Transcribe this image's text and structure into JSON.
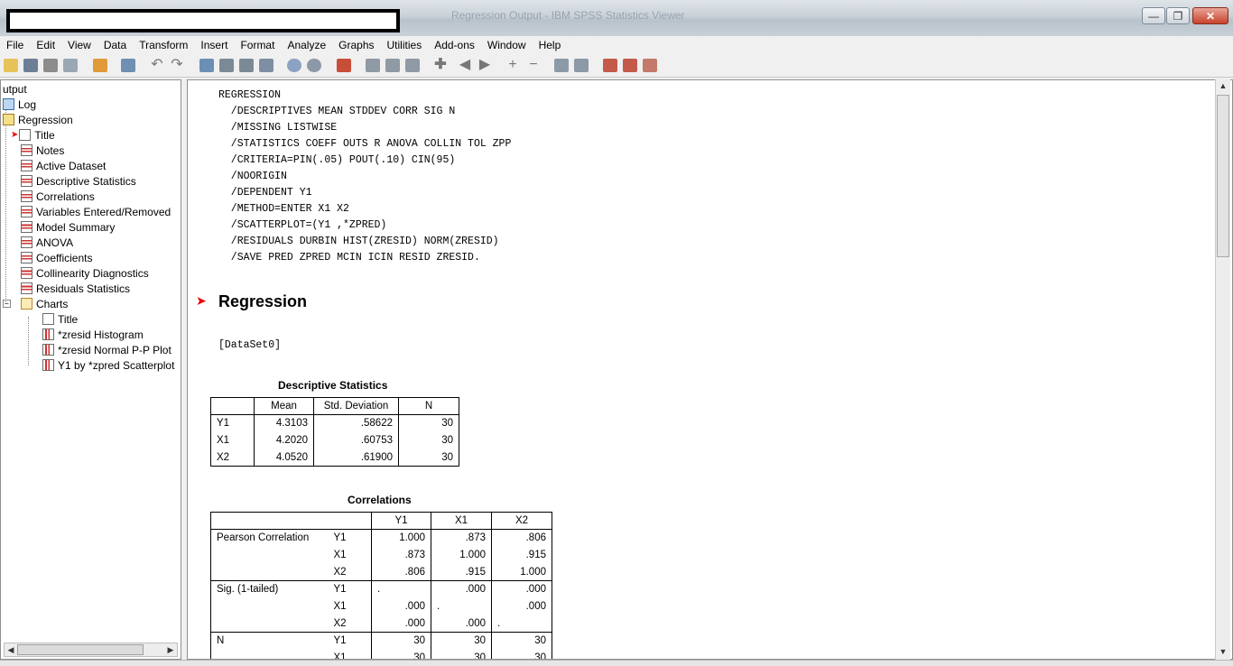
{
  "window": {
    "title": "Regression Output - IBM SPSS Statistics Viewer"
  },
  "menu": [
    "File",
    "Edit",
    "View",
    "Data",
    "Transform",
    "Insert",
    "Format",
    "Analyze",
    "Graphs",
    "Utilities",
    "Add-ons",
    "Window",
    "Help"
  ],
  "outline": {
    "root": "utput",
    "items": [
      {
        "label": "Log",
        "level": 1,
        "icon": "log-icon"
      },
      {
        "label": "Regression",
        "level": 1,
        "icon": "book-icon"
      },
      {
        "label": "Title",
        "level": 2,
        "icon": "title-icon",
        "selected": true
      },
      {
        "label": "Notes",
        "level": 2,
        "icon": "notes-icon"
      },
      {
        "label": "Active Dataset",
        "level": 2,
        "icon": "table-icon"
      },
      {
        "label": "Descriptive Statistics",
        "level": 2,
        "icon": "table-icon"
      },
      {
        "label": "Correlations",
        "level": 2,
        "icon": "table-icon"
      },
      {
        "label": "Variables Entered/Removed",
        "level": 2,
        "icon": "table-icon"
      },
      {
        "label": "Model Summary",
        "level": 2,
        "icon": "table-icon"
      },
      {
        "label": "ANOVA",
        "level": 2,
        "icon": "table-icon"
      },
      {
        "label": "Coefficients",
        "level": 2,
        "icon": "table-icon"
      },
      {
        "label": "Collinearity Diagnostics",
        "level": 2,
        "icon": "table-icon"
      },
      {
        "label": "Residuals Statistics",
        "level": 2,
        "icon": "table-icon"
      },
      {
        "label": "Charts",
        "level": 2,
        "icon": "folder-icon"
      },
      {
        "label": "Title",
        "level": 3,
        "icon": "title-icon"
      },
      {
        "label": "*zresid Histogram",
        "level": 3,
        "icon": "chart-icon"
      },
      {
        "label": "*zresid Normal P-P Plot",
        "level": 3,
        "icon": "chart-icon"
      },
      {
        "label": "Y1 by *zpred Scatterplot",
        "level": 3,
        "icon": "chart-icon"
      }
    ]
  },
  "syntax": [
    "REGRESSION",
    "  /DESCRIPTIVES MEAN STDDEV CORR SIG N",
    "  /MISSING LISTWISE",
    "  /STATISTICS COEFF OUTS R ANOVA COLLIN TOL ZPP",
    "  /CRITERIA=PIN(.05) POUT(.10) CIN(95)",
    "  /NOORIGIN",
    "  /DEPENDENT Y1",
    "  /METHOD=ENTER X1 X2",
    "  /SCATTERPLOT=(Y1 ,*ZPRED)",
    "  /RESIDUALS DURBIN HIST(ZRESID) NORM(ZRESID)",
    "  /SAVE PRED ZPRED MCIN ICIN RESID ZRESID."
  ],
  "heading": "Regression",
  "dataset": "[DataSet0]",
  "descriptives": {
    "title": "Descriptive Statistics",
    "headers": [
      "",
      "Mean",
      "Std. Deviation",
      "N"
    ],
    "rows": [
      [
        "Y1",
        "4.3103",
        ".58622",
        "30"
      ],
      [
        "X1",
        "4.2020",
        ".60753",
        "30"
      ],
      [
        "X2",
        "4.0520",
        ".61900",
        "30"
      ]
    ]
  },
  "correlations": {
    "title": "Correlations",
    "headers": [
      "",
      "",
      "Y1",
      "X1",
      "X2"
    ],
    "groups": [
      {
        "label": "Pearson Correlation",
        "rows": [
          [
            "Y1",
            "1.000",
            ".873",
            ".806"
          ],
          [
            "X1",
            ".873",
            "1.000",
            ".915"
          ],
          [
            "X2",
            ".806",
            ".915",
            "1.000"
          ]
        ]
      },
      {
        "label": "Sig. (1-tailed)",
        "rows": [
          [
            "Y1",
            ".",
            ".000",
            ".000"
          ],
          [
            "X1",
            ".000",
            ".",
            ".000"
          ],
          [
            "X2",
            ".000",
            ".000",
            "."
          ]
        ]
      },
      {
        "label": "N",
        "rows": [
          [
            "Y1",
            "30",
            "30",
            "30"
          ],
          [
            "X1",
            "30",
            "30",
            "30"
          ]
        ]
      }
    ]
  }
}
